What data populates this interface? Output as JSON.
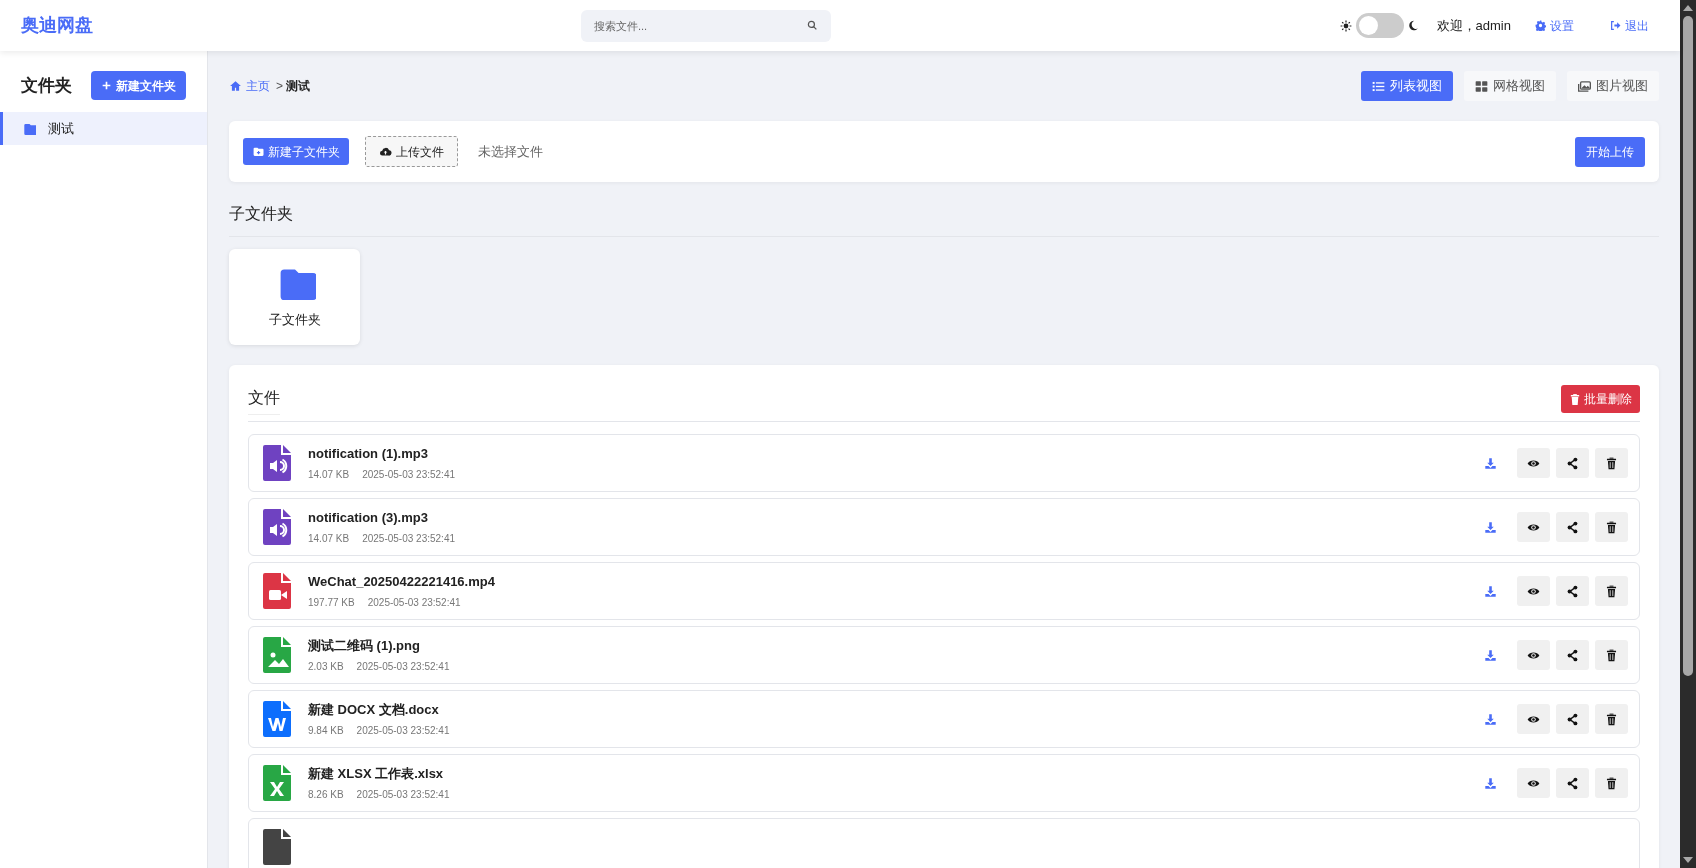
{
  "header": {
    "logo": "奥迪网盘",
    "search": {
      "placeholder": "搜索文件..."
    },
    "dark_mode": {
      "on": false
    },
    "welcome": "欢迎，admin",
    "settings": "设置",
    "logout": "退出"
  },
  "sidebar": {
    "title": "文件夹",
    "new_folder_button": "新建文件夹",
    "items": [
      {
        "label": "测试",
        "selected": true
      }
    ]
  },
  "breadcrumb": {
    "home": "主页",
    "separator": ">",
    "current": "测试"
  },
  "view_tabs": [
    {
      "label": "列表视图",
      "kind": "list",
      "selected": true
    },
    {
      "label": "网格视图",
      "kind": "grid",
      "selected": false
    },
    {
      "label": "图片视图",
      "kind": "image",
      "selected": false
    }
  ],
  "upload_bar": {
    "new_subfolder_button": "新建子文件夹",
    "upload_button": "上传文件",
    "file_status": "未选择文件",
    "start_button": "开始上传"
  },
  "subfolders": {
    "title": "子文件夹",
    "items": [
      {
        "label": "子文件夹"
      }
    ]
  },
  "files": {
    "title": "文件",
    "batch_delete_button": "批量删除",
    "rows": [
      {
        "kind": "audio",
        "name": "notification (1).mp3",
        "size": "14.07 KB",
        "date": "2025-05-03 23:52:41"
      },
      {
        "kind": "audio",
        "name": "notification (3).mp3",
        "size": "14.07 KB",
        "date": "2025-05-03 23:52:41"
      },
      {
        "kind": "video",
        "name": "WeChat_20250422221416.mp4",
        "size": "197.77 KB",
        "date": "2025-05-03 23:52:41"
      },
      {
        "kind": "image",
        "name": "测试二维码 (1).png",
        "size": "2.03 KB",
        "date": "2025-05-03 23:52:41"
      },
      {
        "kind": "word",
        "name": "新建 DOCX 文档.docx",
        "size": "9.84 KB",
        "date": "2025-05-03 23:52:41"
      },
      {
        "kind": "excel",
        "name": "新建 XLSX 工作表.xlsx",
        "size": "8.26 KB",
        "date": "2025-05-03 23:52:41"
      },
      {
        "kind": "other"
      }
    ]
  }
}
